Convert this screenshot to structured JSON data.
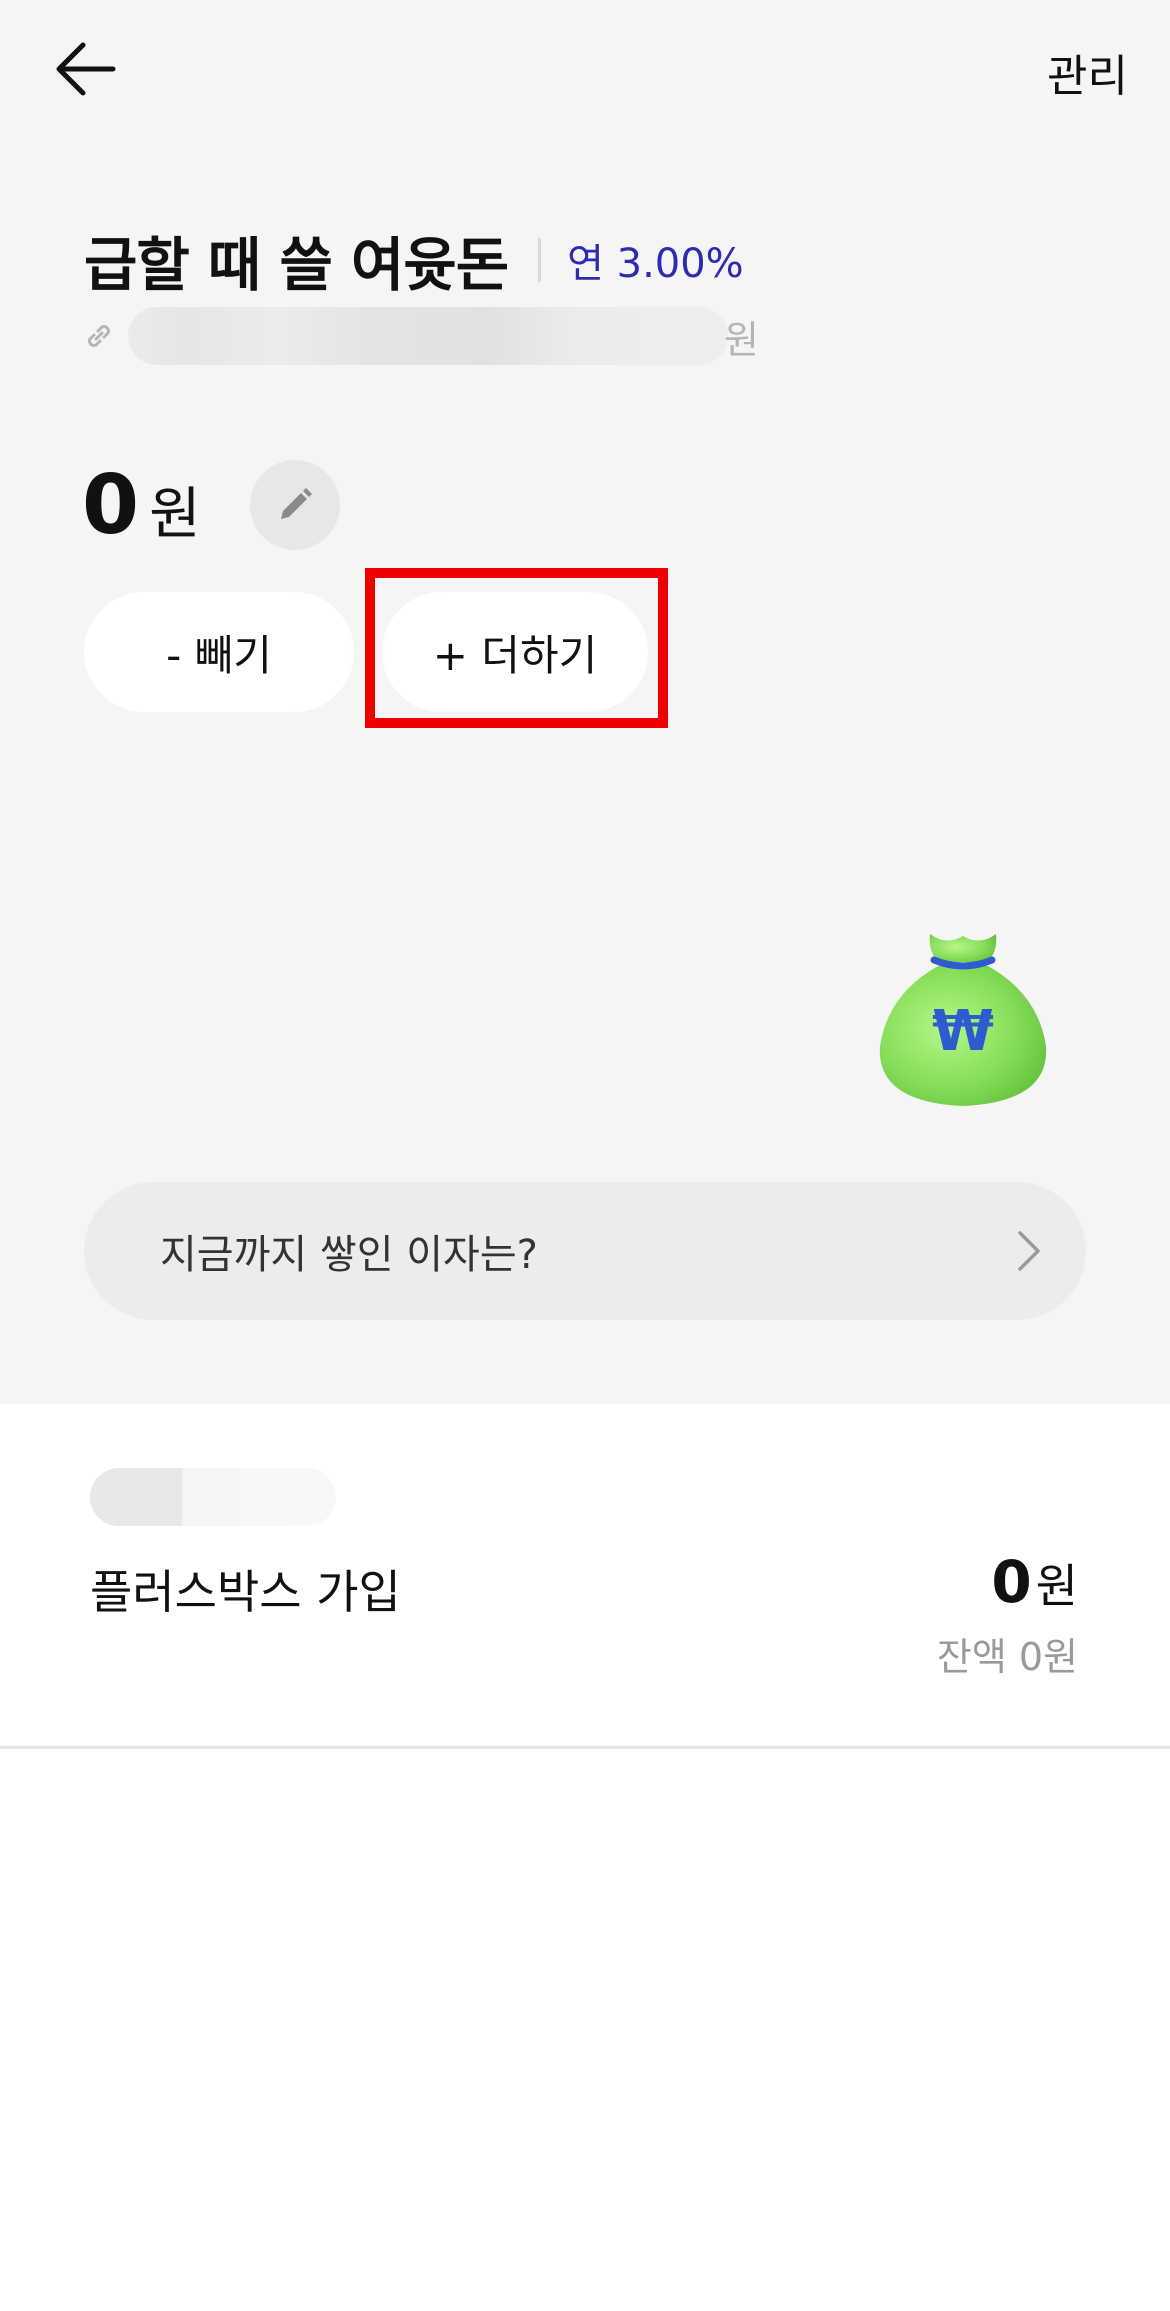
{
  "header": {
    "back_icon": "arrow-left-icon",
    "manage_label": "관리"
  },
  "account": {
    "title": "급할 때 쓸 여윳돈",
    "rate": "연 3.00%",
    "link_icon": "link-icon",
    "account_suffix": "원",
    "balance_value": "0",
    "balance_unit": "원",
    "edit_icon": "pencil-icon"
  },
  "actions": {
    "minus_label": "- 빼기",
    "plus_label": "+ 더하기"
  },
  "illustration": {
    "icon": "money-bag-icon",
    "symbol": "₩"
  },
  "interest": {
    "label": "지금까지 쌓인 이자는?",
    "chevron": "chevron-right-icon"
  },
  "transactions": [
    {
      "title": "플러스박스 가입",
      "amount": "0",
      "amount_unit": "원",
      "balance": "잔액 0원"
    }
  ],
  "colors": {
    "highlight": "#ee0000",
    "rate_text": "#2e2bb0",
    "bag_green": "#8be05a"
  }
}
